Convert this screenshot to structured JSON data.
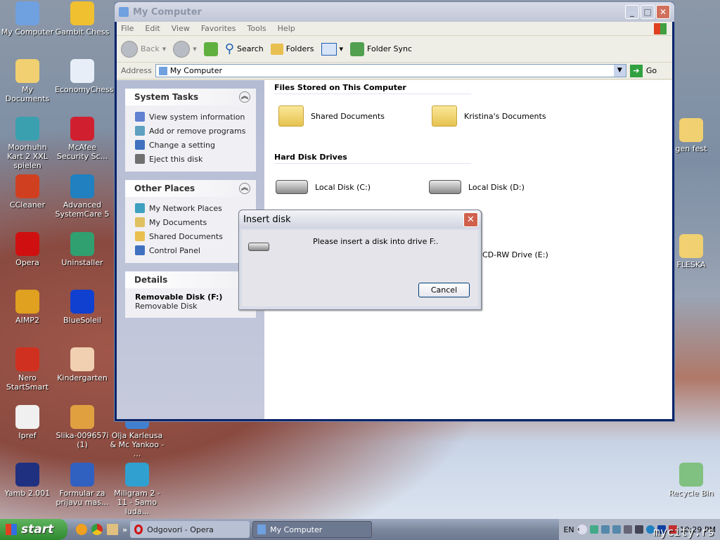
{
  "desktop": {
    "icons": [
      {
        "label": "My Computer",
        "color": "#6fa0e0"
      },
      {
        "label": "Gambit Chess",
        "color": "#f0c030"
      },
      {
        "label": "My Documents",
        "color": "#f0d070"
      },
      {
        "label": "EconomyChess",
        "color": "#e8eef8"
      },
      {
        "label": "Moorhuhn Kart 2 XXL spielen",
        "color": "#3aa0b0"
      },
      {
        "label": "McAfee Security Sc...",
        "color": "#d02030"
      },
      {
        "label": "CCleaner",
        "color": "#d04020"
      },
      {
        "label": "Advanced SystemCare 5",
        "color": "#2080c0"
      },
      {
        "label": "Opera",
        "color": "#d01010"
      },
      {
        "label": "Uninstaller",
        "color": "#30a070"
      },
      {
        "label": "AIMP2",
        "color": "#e0a020"
      },
      {
        "label": "BlueSoleil",
        "color": "#1040d0"
      },
      {
        "label": "Nero StartSmart",
        "color": "#d03020"
      },
      {
        "label": "Kindergarten",
        "color": "#f0d0b0"
      },
      {
        "label": "Ipref",
        "color": "#f0f0f0"
      },
      {
        "label": "Slika-009657i (1)",
        "color": "#e0a040"
      },
      {
        "label": "Olja Karleusa & Mc Yankoo - ...",
        "color": "#4080d0"
      },
      {
        "label": "Yamb 2.001",
        "color": "#203080"
      },
      {
        "label": "Formular za prijavu mas...",
        "color": "#3060c0"
      },
      {
        "label": "Miligram 2 - 11 - Samo luda...",
        "color": "#30a0d0"
      },
      {
        "label": "gen fest",
        "color": "#f0d070"
      },
      {
        "label": "FLESKA",
        "color": "#f0d070"
      },
      {
        "label": "Recycle Bin",
        "color": "#80c080"
      }
    ]
  },
  "window": {
    "title": "My Computer",
    "menu": [
      "File",
      "Edit",
      "View",
      "Favorites",
      "Tools",
      "Help"
    ],
    "toolbar": {
      "back": "Back",
      "search": "Search",
      "folders": "Folders",
      "folder_sync": "Folder Sync"
    },
    "address": {
      "label": "Address",
      "value": "My Computer",
      "go": "Go"
    },
    "system_tasks": {
      "title": "System Tasks",
      "items": [
        "View system information",
        "Add or remove programs",
        "Change a setting",
        "Eject this disk"
      ]
    },
    "other_places": {
      "title": "Other Places",
      "items": [
        "My Network Places",
        "My Documents",
        "Shared Documents",
        "Control Panel"
      ]
    },
    "details": {
      "title": "Details",
      "name": "Removable Disk (F:)",
      "type": "Removable Disk"
    },
    "files_section": "Files Stored on This Computer",
    "files": [
      "Shared Documents",
      "Kristina's Documents"
    ],
    "hdd_section": "Hard Disk Drives",
    "drives": [
      "Local Disk (C:)",
      "Local Disk (D:)"
    ],
    "cd_drive": "CD-RW Drive (E:)"
  },
  "dialog": {
    "title": "Insert disk",
    "message": "Please insert a disk into drive F:.",
    "cancel": "Cancel"
  },
  "taskbar": {
    "start": "start",
    "tasks": [
      "Odgovori - Opera",
      "My Computer"
    ],
    "lang": "EN",
    "clock": "10:29 PM"
  },
  "watermark": "mycity.rs"
}
